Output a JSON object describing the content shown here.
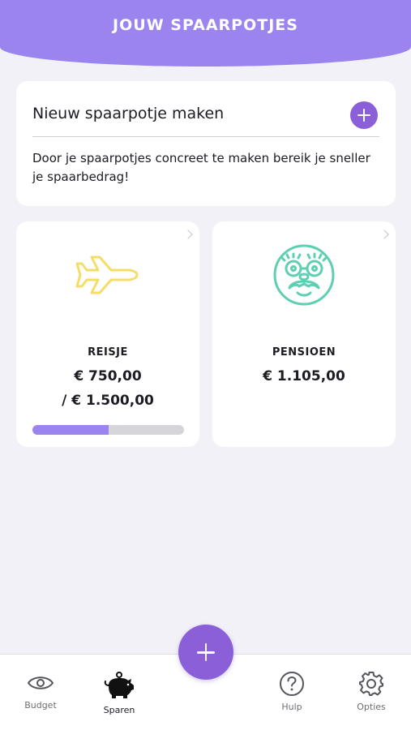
{
  "header": {
    "title": "JOUW SPAARPOTJES"
  },
  "new_pot": {
    "title": "Nieuw spaarpotje maken",
    "description": "Door je spaarpotjes concreet te maken bereik je sneller je spaarbedrag!",
    "add_icon": "plus-icon"
  },
  "pots": [
    {
      "name": "REISJE",
      "amount": "€ 750,00",
      "goal": "/ € 1.500,00",
      "progress": 0.5,
      "icon": "airplane-icon",
      "icon_color": "#f5dd6a"
    },
    {
      "name": "PENSIOEN",
      "amount": "€ 1.105,00",
      "icon": "old-face-icon",
      "icon_color": "#5fcfb3"
    }
  ],
  "colors": {
    "accent": "#8a5fd8",
    "header": "#9b84ee",
    "progress_fill": "#9b84ee",
    "progress_track": "#d6d6da"
  },
  "nav": {
    "items": [
      {
        "label": "Budget",
        "icon": "eye-icon"
      },
      {
        "label": "Sparen",
        "icon": "piggy-bank-icon",
        "active": true
      },
      {
        "label": "Hulp",
        "icon": "help-icon"
      },
      {
        "label": "Opties",
        "icon": "gear-icon"
      }
    ],
    "fab_icon": "plus-icon"
  }
}
